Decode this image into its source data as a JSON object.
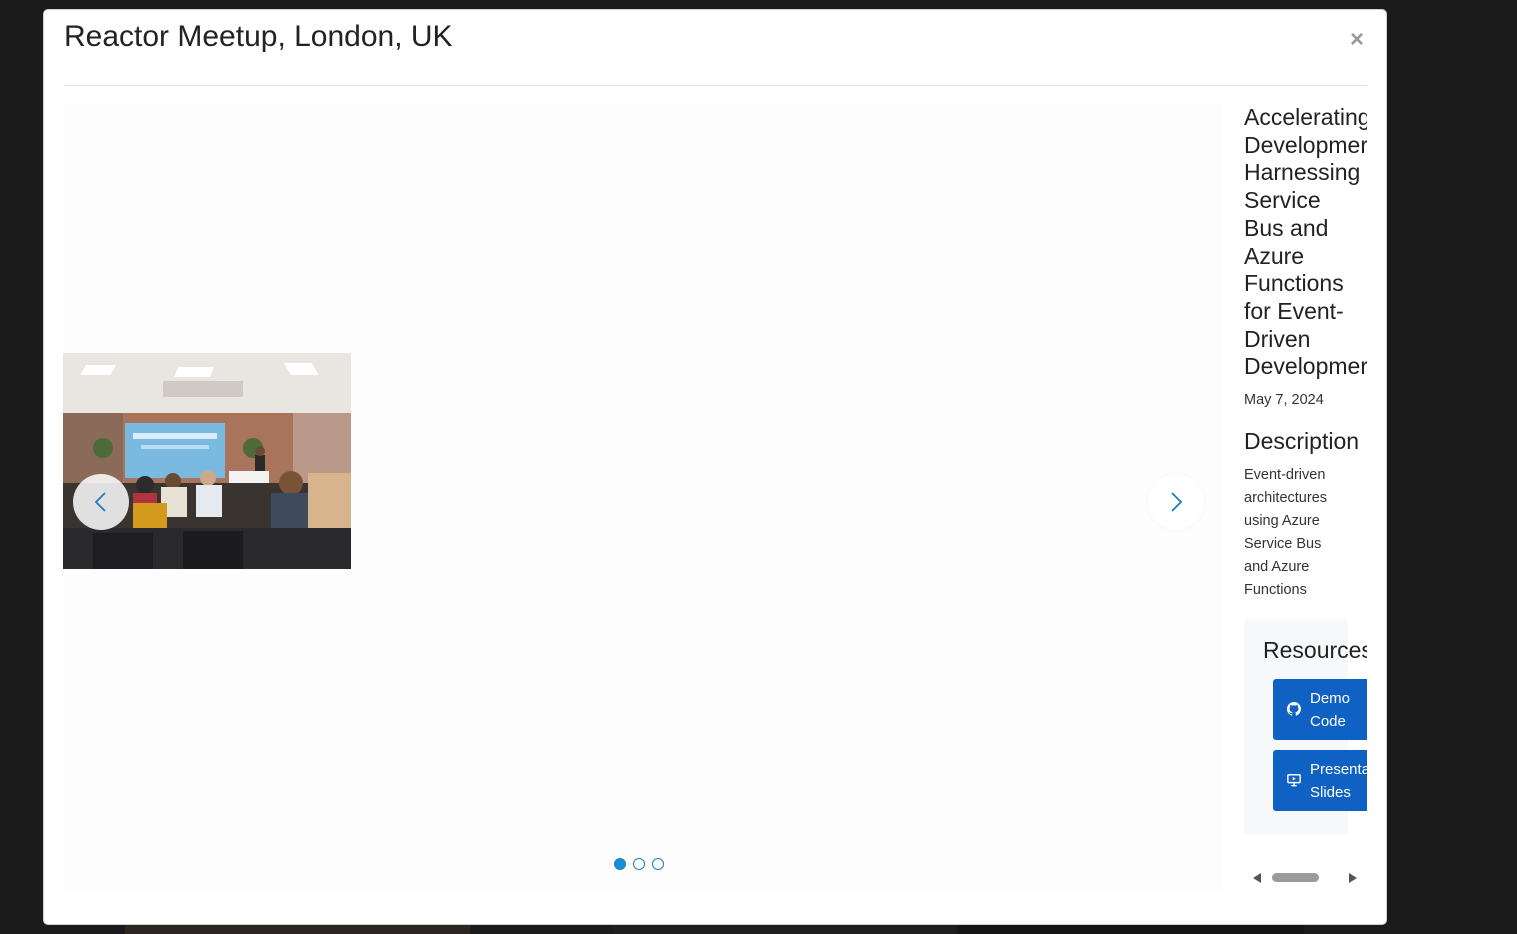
{
  "modal": {
    "title": "Reactor Meetup, London, UK",
    "close_symbol": "×"
  },
  "carousel": {
    "current_slide": 1,
    "total_slides": 3,
    "image_alt": "photo-of-audience-at-presentation",
    "prev_icon": "chevron-left-icon",
    "next_icon": "chevron-right-icon"
  },
  "talk": {
    "title": "Accelerating\nDevelopmer\nHarnessing\nService\nBus and\nAzure\nFunctions\nfor Event-\nDriven\nDevelopmer",
    "date": "May 7, 2024",
    "description_heading": "Description",
    "description": "Event-driven\narchitectures\nusing Azure\nService Bus\nand Azure\nFunctions"
  },
  "resources": {
    "heading": "Resources",
    "demo_label": "Demo\nCode",
    "demo_icon": "github-icon",
    "slides_label": "Presenta\nSlides",
    "slides_icon": "presentation-icon"
  },
  "colors": {
    "accent": "#0f62c4",
    "dot_active": "#1a8fd6",
    "arrow": "#1a7fc1",
    "backdrop": "#1b1b1b"
  }
}
